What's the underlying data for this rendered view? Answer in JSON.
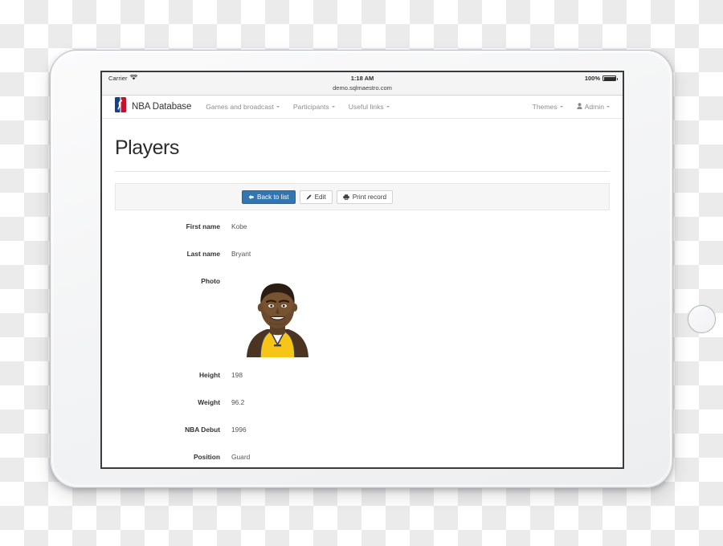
{
  "device": {
    "type": "tablet",
    "camera_icon": "camera-dot",
    "home_button_icon": "home-button-circle"
  },
  "status_bar": {
    "carrier": "Carrier",
    "wifi_icon": "wifi-icon",
    "time": "1:18 AM",
    "battery_percent": "100%",
    "battery_icon": "battery-full-icon"
  },
  "browser": {
    "url": "demo.sqlmaestro.com"
  },
  "navbar": {
    "logo_icon": "nba-logo-icon",
    "brand": "NBA Database",
    "links": [
      {
        "label": "Games and broadcast",
        "has_caret": true
      },
      {
        "label": "Participants",
        "has_caret": true
      },
      {
        "label": "Useful links",
        "has_caret": true
      }
    ],
    "right": [
      {
        "label": "Themes",
        "has_caret": true,
        "icon": null
      },
      {
        "label": "Admin",
        "has_caret": true,
        "icon": "user-icon"
      }
    ]
  },
  "page": {
    "title": "Players"
  },
  "toolbar": {
    "back_label": "Back to list",
    "back_icon": "arrow-left-icon",
    "edit_label": "Edit",
    "edit_icon": "pencil-icon",
    "print_label": "Print record",
    "print_icon": "printer-icon"
  },
  "record": {
    "fields": [
      {
        "label": "First name",
        "value": "Kobe"
      },
      {
        "label": "Last name",
        "value": "Bryant"
      },
      {
        "label": "Photo",
        "value": "",
        "type": "image",
        "image_alt": "player-headshot"
      },
      {
        "label": "Height",
        "value": "198"
      },
      {
        "label": "Weight",
        "value": "96.2"
      },
      {
        "label": "NBA Debut",
        "value": "1996"
      },
      {
        "label": "Position",
        "value": "Guard"
      }
    ]
  },
  "colors": {
    "primary": "#3276b1",
    "primary_border": "#2a6496",
    "toolbar_bg": "#f6f6f6",
    "text_dark": "#333333",
    "text_muted": "#8d8d8d",
    "jersey_gold": "#f5c518",
    "nba_blue": "#17408b",
    "nba_red": "#c8102e"
  }
}
